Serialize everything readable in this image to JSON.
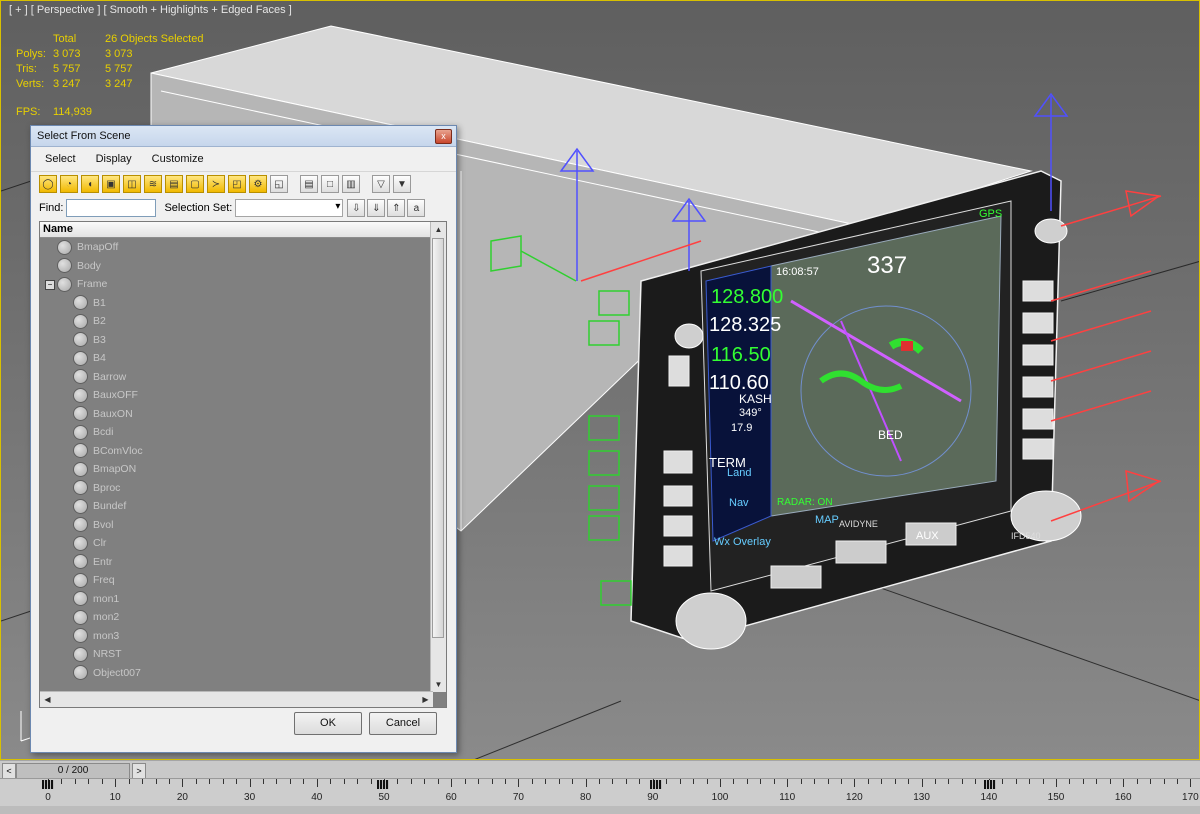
{
  "viewport": {
    "label": "[ + ] [ Perspective ] [ Smooth + Highlights + Edged Faces ]",
    "stats": {
      "header": [
        "",
        "Total",
        "26 Objects Selected"
      ],
      "rows": [
        {
          "name": "Polys:",
          "total": "3 073",
          "selected": "3 073"
        },
        {
          "name": "Tris:",
          "total": "5 757",
          "selected": "5 757"
        },
        {
          "name": "Verts:",
          "total": "3 247",
          "selected": "3 247"
        }
      ],
      "fps_label": "FPS:",
      "fps_value": "114,939"
    },
    "device": {
      "freq1": "128.800",
      "freq2": "128.325",
      "freq3": "116.50",
      "freq4": "110.60",
      "waypoint": "KASH",
      "bearing": "349°",
      "distance": "17.9",
      "mode": "TERM",
      "btn_land": "Land",
      "btn_nav": "Nav",
      "wx": "Wx Overlay",
      "gps_label": "GPS",
      "alt": "337",
      "time": "16:08:57",
      "brand": "AVIDYNE",
      "model": "IFD540",
      "radar": "RADAR: ON",
      "map_btn": "MAP",
      "aux_btn": "AUX",
      "bed": "BED"
    }
  },
  "dialog": {
    "title": "Select From Scene",
    "close": "x",
    "menu": [
      "Select",
      "Display",
      "Customize"
    ],
    "find_label": "Find:",
    "selection_set_label": "Selection Set:",
    "column_header": "Name",
    "expand_glyph": "−",
    "items": [
      {
        "label": "BmapOff",
        "level": 0
      },
      {
        "label": "Body",
        "level": 0
      },
      {
        "label": "Frame",
        "level": 0
      },
      {
        "label": "B1",
        "level": 1
      },
      {
        "label": "B2",
        "level": 1
      },
      {
        "label": "B3",
        "level": 1
      },
      {
        "label": "B4",
        "level": 1
      },
      {
        "label": "Barrow",
        "level": 1
      },
      {
        "label": "BauxOFF",
        "level": 1
      },
      {
        "label": "BauxON",
        "level": 1
      },
      {
        "label": "Bcdi",
        "level": 1
      },
      {
        "label": "BComVloc",
        "level": 1
      },
      {
        "label": "BmapON",
        "level": 1
      },
      {
        "label": "Bproc",
        "level": 1
      },
      {
        "label": "Bundef",
        "level": 1
      },
      {
        "label": "Bvol",
        "level": 1
      },
      {
        "label": "Clr",
        "level": 1
      },
      {
        "label": "Entr",
        "level": 1
      },
      {
        "label": "Freq",
        "level": 1
      },
      {
        "label": "mon1",
        "level": 1
      },
      {
        "label": "mon2",
        "level": 1
      },
      {
        "label": "mon3",
        "level": 1
      },
      {
        "label": "NRST",
        "level": 1
      },
      {
        "label": "Object007",
        "level": 1
      }
    ],
    "ok_label": "OK",
    "cancel_label": "Cancel"
  },
  "timeline": {
    "frame": "0 / 200",
    "prev": "<",
    "next": ">",
    "ruler_labels": [
      "0",
      "10",
      "20",
      "30",
      "40",
      "50",
      "60",
      "70",
      "80",
      "90",
      "100",
      "110",
      "120",
      "130",
      "140",
      "150",
      "160",
      "170"
    ]
  }
}
